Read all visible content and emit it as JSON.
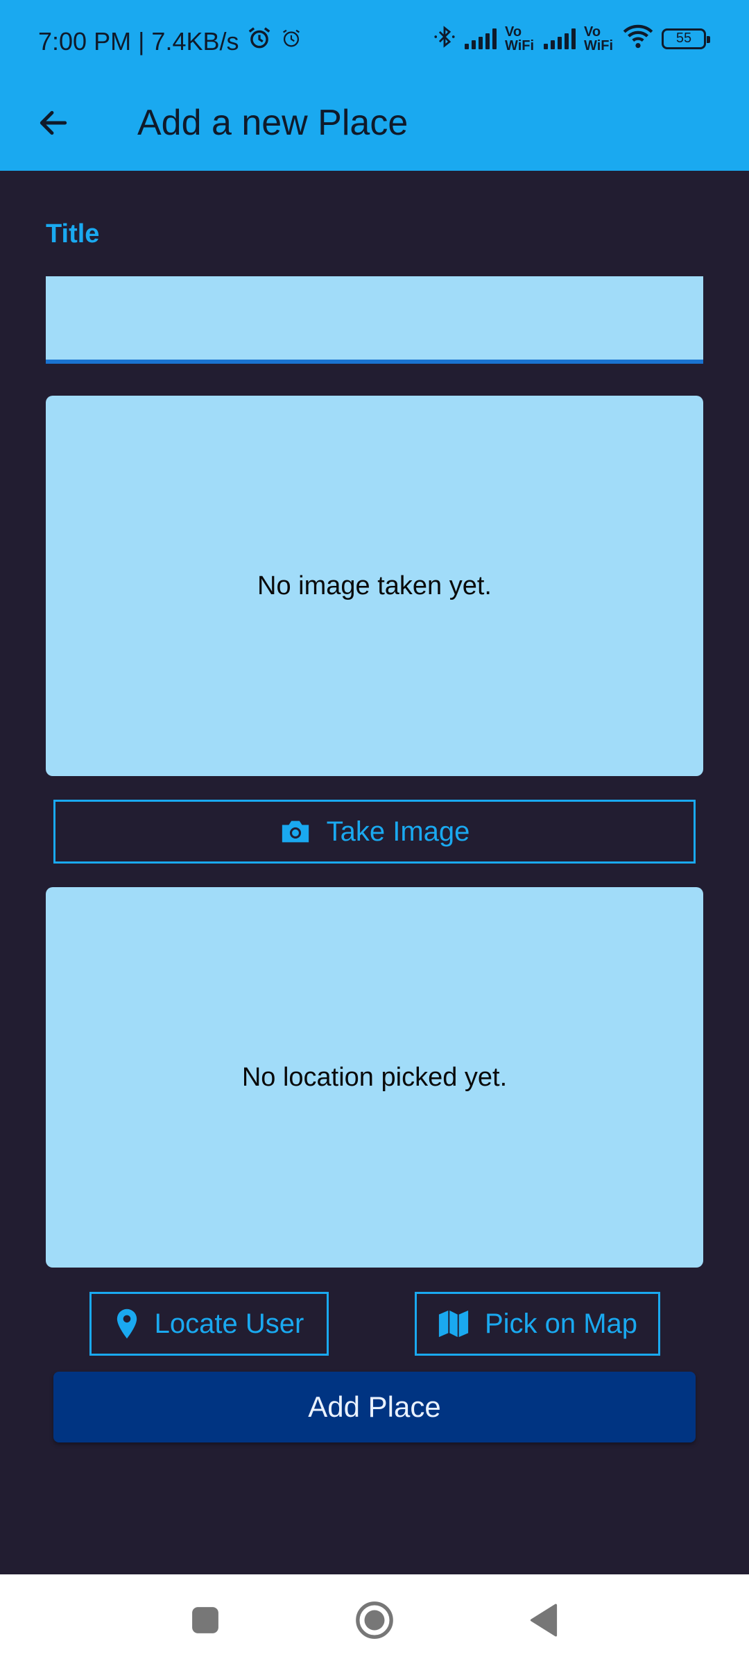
{
  "status_bar": {
    "time_speed": "7:00 PM | 7.4KB/s",
    "vowifi_1": "Vo\nWiFi",
    "vowifi_2": "Vo\nWiFi",
    "battery": "55",
    "icons": [
      "alarm-icon",
      "alarm-outline-icon",
      "bluetooth-icon",
      "signal-icon",
      "wifi-icon",
      "battery-icon"
    ]
  },
  "app_bar": {
    "title": "Add a new Place",
    "back_icon": "arrow-back-icon"
  },
  "form": {
    "title_label": "Title",
    "title_value": ""
  },
  "image_input": {
    "placeholder": "No image taken yet.",
    "button_label": "Take Image",
    "button_icon": "camera-icon"
  },
  "location_input": {
    "placeholder": "No location picked yet.",
    "locate_label": "Locate User",
    "locate_icon": "location-pin-icon",
    "pick_label": "Pick on Map",
    "pick_icon": "map-icon"
  },
  "submit": {
    "label": "Add Place"
  },
  "nav_bar": {
    "icons": [
      "recents-square-icon",
      "home-circle-icon",
      "back-triangle-icon"
    ]
  },
  "colors": {
    "accent": "#1AA9F0",
    "background": "#221D31",
    "card": "#A1DCF9",
    "primary_button": "#003482"
  }
}
